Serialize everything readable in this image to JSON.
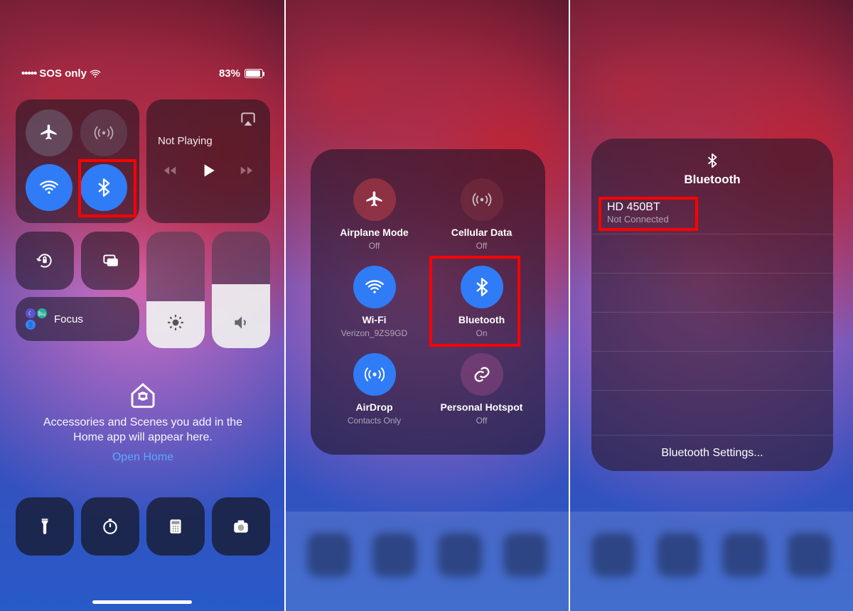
{
  "status": {
    "network_text": "SOS only",
    "battery_pct": "83%"
  },
  "media": {
    "state_label": "Not Playing"
  },
  "focus_label": "Focus",
  "home": {
    "text": "Accessories and Scenes you add in the Home app will appear here.",
    "link": "Open Home"
  },
  "conn": {
    "airplane": {
      "label": "Airplane Mode",
      "status": "Off"
    },
    "cellular": {
      "label": "Cellular Data",
      "status": "Off"
    },
    "wifi": {
      "label": "Wi-Fi",
      "status": "Verizon_9ZS9GD"
    },
    "bluetooth": {
      "label": "Bluetooth",
      "status": "On"
    },
    "airdrop": {
      "label": "AirDrop",
      "status": "Contacts Only"
    },
    "hotspot": {
      "label": "Personal Hotspot",
      "status": "Off"
    }
  },
  "bt": {
    "title": "Bluetooth",
    "device_name": "HD 450BT",
    "device_status": "Not Connected",
    "settings_label": "Bluetooth Settings..."
  }
}
